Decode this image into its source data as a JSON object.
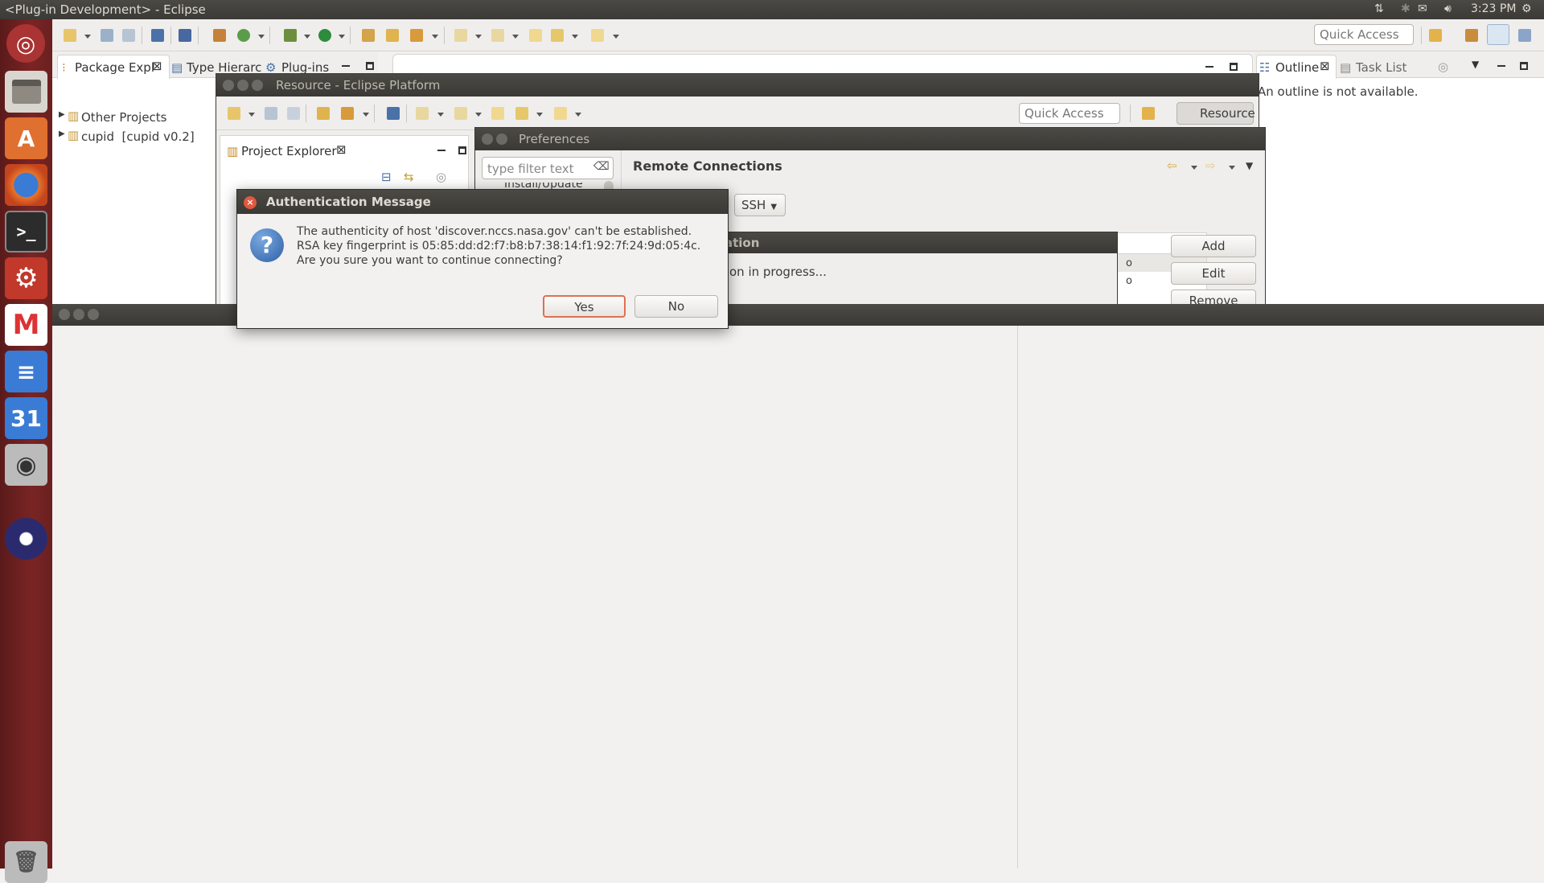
{
  "topbar": {
    "title": "<Plug-in Development> - Eclipse",
    "time": "3:23 PM"
  },
  "main_window": {
    "quick_access_placeholder": "Quick Access",
    "tabs_left": [
      "Package Expl",
      "Type Hierarc",
      "Plug-ins"
    ],
    "tree": [
      "Other Projects",
      "cupid  [cupid v0.2]"
    ],
    "tabs_right": [
      "Outline",
      "Task List"
    ],
    "outline_message": "An outline is not available."
  },
  "resource_window": {
    "title": "Resource - Eclipse Platform",
    "quick_access_placeholder": "Quick Access",
    "perspective_button": "Resource",
    "project_explorer_tab": "Project Explorer"
  },
  "preferences": {
    "title": "Preferences",
    "filter_placeholder": "type filter text",
    "tree_partial_item": "Install/Update",
    "page_title": "Remote Connections",
    "connection_type": "SSH",
    "buttons": {
      "add": "Add",
      "edit": "Edit",
      "remove": "Remove"
    },
    "inner_title_partial": "ation",
    "progress_partial": "on in progress..."
  },
  "auth_dialog": {
    "title": "Authentication Message",
    "lines": [
      "The authenticity of host 'discover.nccs.nasa.gov' can't be established.",
      "RSA key fingerprint is 05:85:dd:d2:f7:b8:b7:38:14:f1:92:7f:24:9d:05:4c.",
      "Are you sure you want to continue connecting?"
    ],
    "yes_label": "Yes",
    "no_label": "No"
  },
  "launcher": {
    "items": [
      "ubuntu-dash-icon",
      "files-icon",
      "software-center-icon",
      "firefox-icon",
      "terminal-icon",
      "system-settings-icon",
      "gmail-icon",
      "docs-icon",
      "calendar-icon",
      "camera-icon",
      "eclipse-icon",
      "trash-icon"
    ],
    "calendar_day": "31"
  },
  "colors": {
    "launcher": "#7a2424",
    "titlebar": "#3b3a36",
    "dialog_close": "#e2583e",
    "yes_border": "#e07050"
  }
}
